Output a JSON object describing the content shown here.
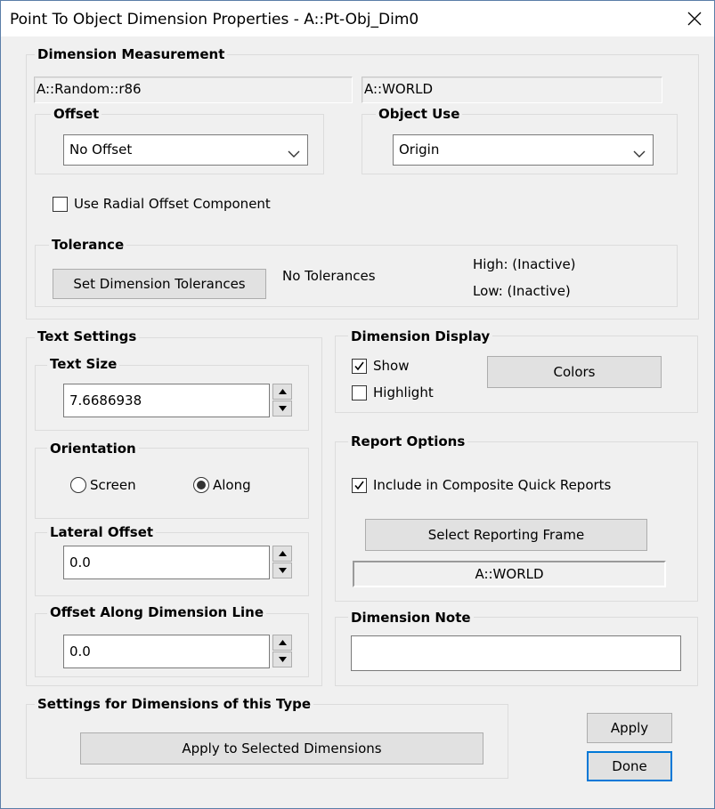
{
  "window": {
    "title": "Point To Object Dimension Properties - A::Pt-Obj_Dim0",
    "close_icon": "close-icon"
  },
  "dimension_measurement": {
    "label": "Dimension Measurement",
    "entity_a": "A::Random::r86",
    "entity_b": "A::WORLD",
    "offset": {
      "label": "Offset",
      "selected": "No Offset"
    },
    "object_use": {
      "label": "Object Use",
      "selected": "Origin"
    },
    "radial_offset": {
      "label": "Use Radial Offset Component",
      "checked": false
    },
    "tolerance": {
      "label": "Tolerance",
      "button": "Set Dimension Tolerances",
      "status": "No Tolerances",
      "high": "High: (Inactive)",
      "low": "Low: (Inactive)"
    }
  },
  "text_settings": {
    "label": "Text Settings",
    "text_size": {
      "label": "Text Size",
      "value": "7.6686938"
    },
    "orientation": {
      "label": "Orientation",
      "options": [
        "Screen",
        "Along"
      ],
      "selected": "Along"
    },
    "lateral_offset": {
      "label": "Lateral Offset",
      "value": "0.0"
    },
    "offset_along": {
      "label": "Offset Along Dimension Line",
      "value": "0.0"
    }
  },
  "dimension_display": {
    "label": "Dimension Display",
    "show": {
      "label": "Show",
      "checked": true
    },
    "highlight": {
      "label": "Highlight",
      "checked": false
    },
    "colors_button": "Colors"
  },
  "report_options": {
    "label": "Report Options",
    "include": {
      "label": "Include in Composite Quick Reports",
      "checked": true
    },
    "select_frame_button": "Select Reporting Frame",
    "frame_value": "A::WORLD"
  },
  "dimension_note": {
    "label": "Dimension Note",
    "value": ""
  },
  "settings_for_type": {
    "label": "Settings for Dimensions of this Type",
    "button": "Apply to Selected Dimensions"
  },
  "footer": {
    "apply": "Apply",
    "done": "Done"
  }
}
